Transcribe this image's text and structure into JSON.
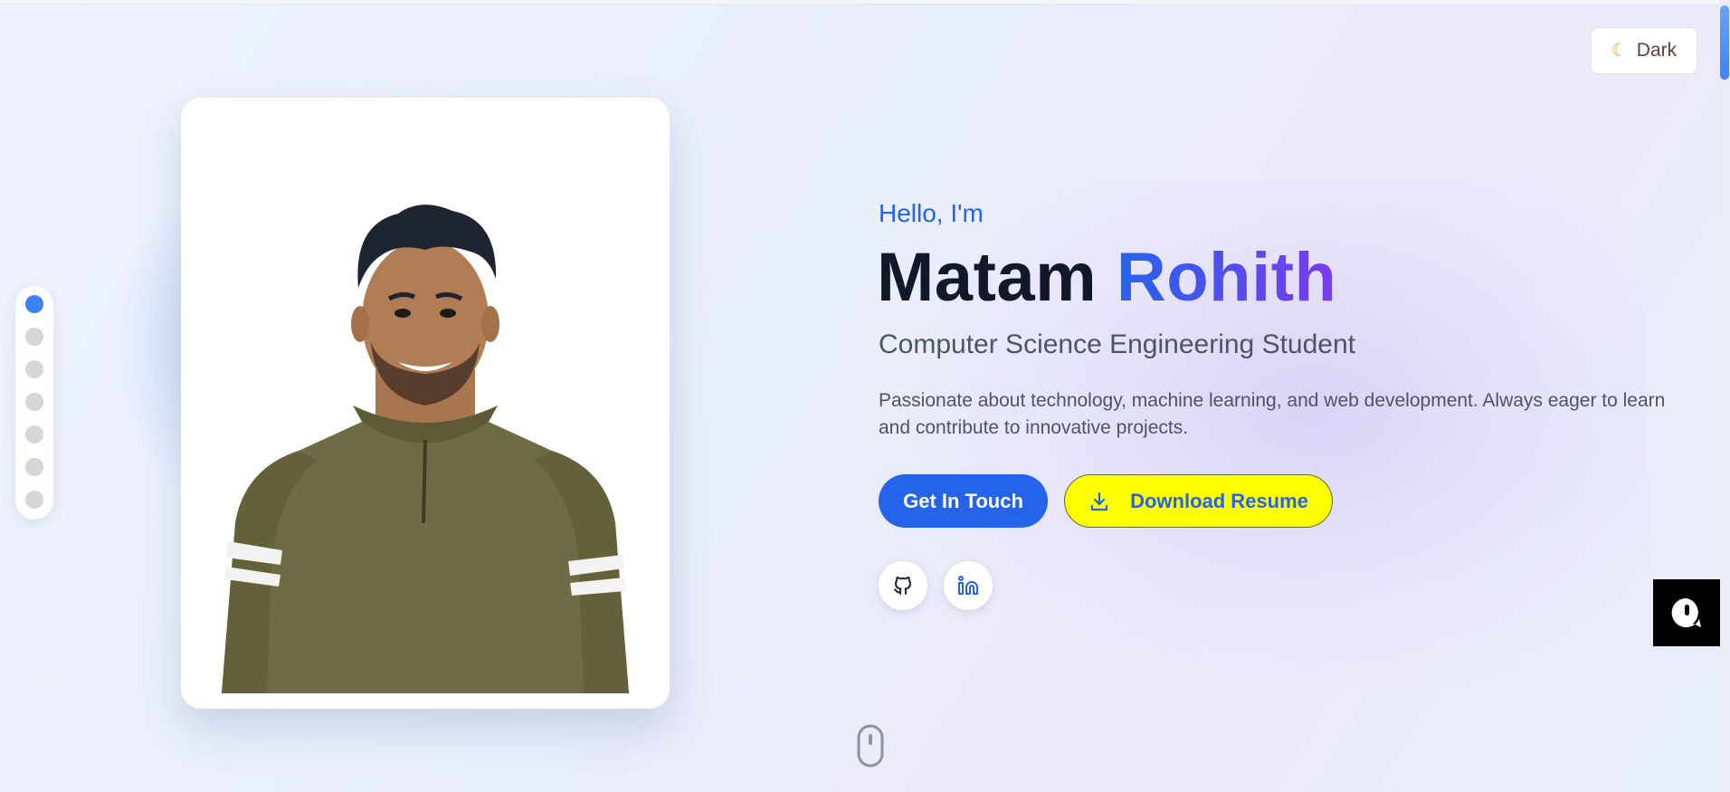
{
  "theme_toggle": {
    "icon": "moon-icon",
    "label": "Dark"
  },
  "section_nav": {
    "dots": 7,
    "active_index": 0
  },
  "photo": {
    "alt": "Portrait photo"
  },
  "hero": {
    "greeting": "Hello, I'm",
    "first_name": "Matam",
    "last_name": "Rohith",
    "role": "Computer Science Engineering Student",
    "description": "Passionate about technology, machine learning, and web development. Always eager to learn and contribute to innovative projects.",
    "primary_button": "Get In Touch",
    "secondary_button": "Download Resume",
    "secondary_button_icon": "download-icon"
  },
  "socials": [
    {
      "name": "GitHub",
      "icon": "github-icon"
    },
    {
      "name": "LinkedIn",
      "icon": "linkedin-icon"
    }
  ],
  "chat_widget": {
    "icon": "chat-icon"
  },
  "scroll_indicator": {
    "icon": "mouse-icon"
  },
  "colors": {
    "accent": "#2563eb",
    "gradient_end": "#7c3aed",
    "resume_button_bg": "#ffff00",
    "active_dot": "#3b82f6"
  }
}
